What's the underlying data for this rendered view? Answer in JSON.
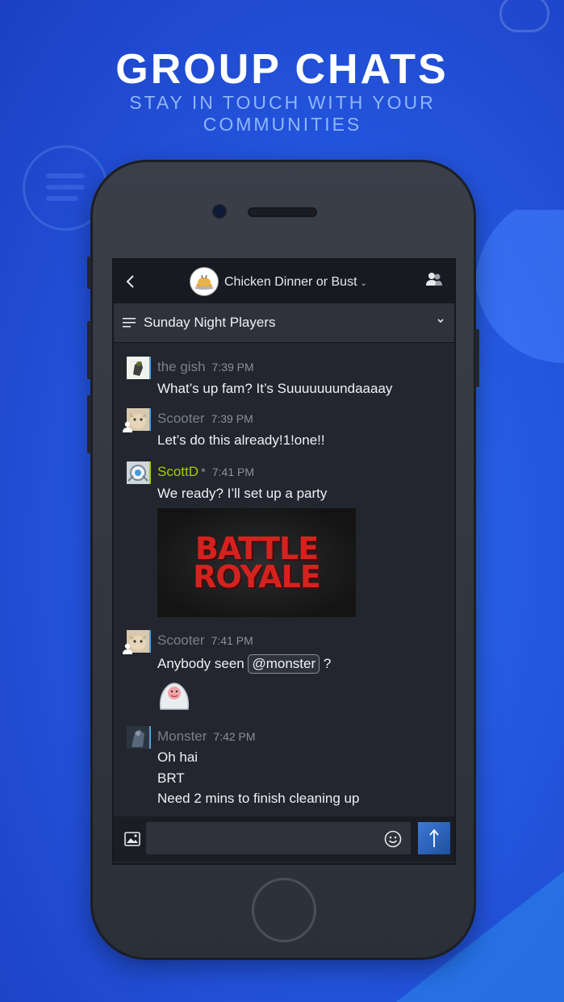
{
  "header": {
    "title": "GROUP CHATS",
    "subtitle": "STAY IN TOUCH WITH YOUR COMMUNITIES"
  },
  "chat": {
    "group_name": "Chicken Dinner or Bust",
    "channel_name": "Sunday Night Players",
    "messages": [
      {
        "user": "the gish",
        "time": "7:39 PM",
        "lines": [
          "What’s up fam? It’s Suuuuuuundaaaay"
        ]
      },
      {
        "user": "Scooter",
        "time": "7:39 PM",
        "lines": [
          "Let’s do this already!1!one!!"
        ]
      },
      {
        "user": "ScottD",
        "user_suffix": "*",
        "time": "7:41 PM",
        "lines": [
          "We ready? I’ll set up a party"
        ],
        "image_text": [
          "BATTLE",
          "ROYALE"
        ]
      },
      {
        "user": "Scooter",
        "time": "7:41 PM",
        "text_before": "Anybody seen",
        "mention": "@monster",
        "text_after": "?"
      },
      {
        "user": "Monster",
        "time": "7:42 PM",
        "lines": [
          "Oh hai",
          "BRT",
          "Need 2 mins to finish cleaning up"
        ]
      }
    ]
  },
  "icons": {
    "back": "chevron-left-icon",
    "members": "members-icon",
    "channel_menu": "menu-icon",
    "channel_caret": "chevron-down-icon",
    "attach": "image-icon",
    "emoji": "emoji-icon",
    "send": "send-arrow-icon"
  },
  "colors": {
    "background": "#2457e0",
    "accent_green": "#a3cf06",
    "status_blue": "#5a9fd6",
    "send_button": "#3d79d8"
  }
}
